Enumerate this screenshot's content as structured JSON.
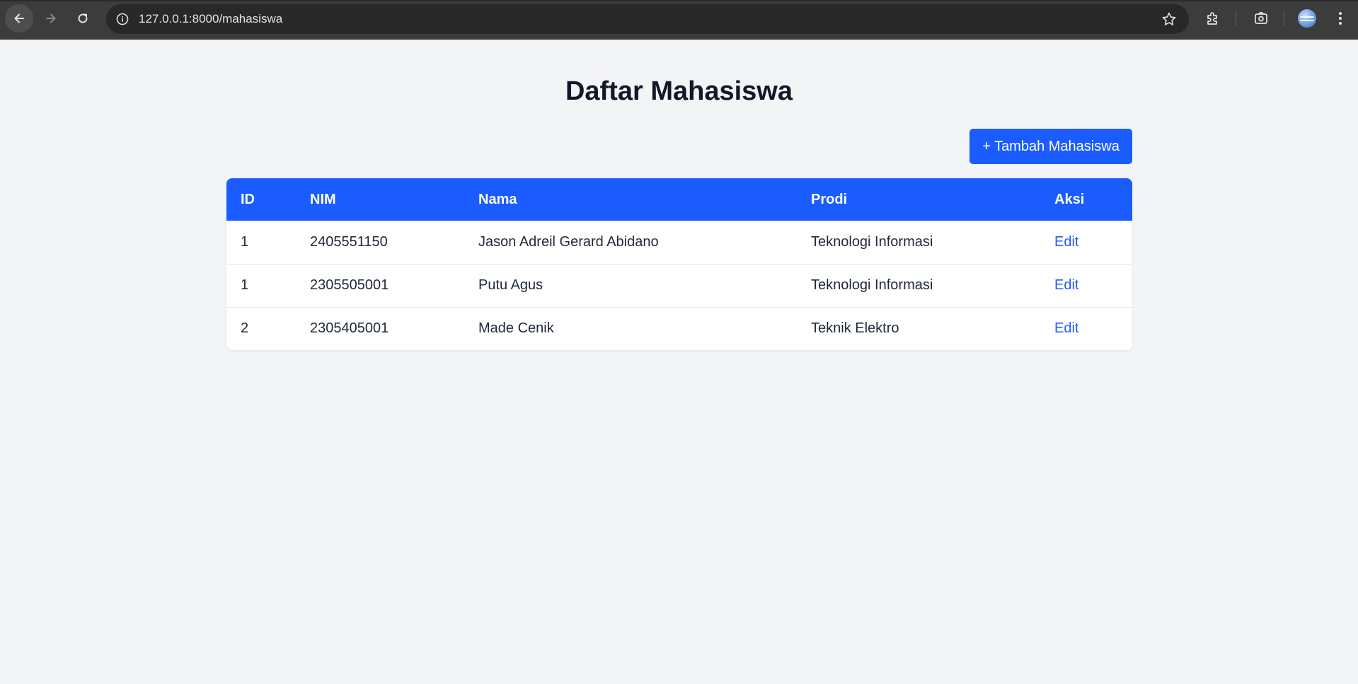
{
  "browser": {
    "url": "127.0.0.1:8000/mahasiswa"
  },
  "page": {
    "title": "Daftar Mahasiswa",
    "add_button_label": "+ Tambah Mahasiswa"
  },
  "table": {
    "headers": {
      "id": "ID",
      "nim": "NIM",
      "nama": "Nama",
      "prodi": "Prodi",
      "aksi": "Aksi"
    },
    "rows": [
      {
        "id": "1",
        "nim": "2405551150",
        "nama": "Jason Adreil Gerard Abidano",
        "prodi": "Teknologi Informasi",
        "aksi": "Edit"
      },
      {
        "id": "1",
        "nim": "2305505001",
        "nama": "Putu Agus",
        "prodi": "Teknologi Informasi",
        "aksi": "Edit"
      },
      {
        "id": "2",
        "nim": "2305405001",
        "nama": "Made Cenik",
        "prodi": "Teknik Elektro",
        "aksi": "Edit"
      }
    ]
  },
  "colors": {
    "accent": "#1a5cff",
    "background": "#f3f4f6",
    "title": "#111827"
  },
  "icons": [
    "back-arrow-icon",
    "forward-arrow-icon",
    "reload-icon",
    "site-info-icon",
    "bookmark-star-icon",
    "extensions-icon",
    "screenshot-icon",
    "profile-avatar-icon",
    "menu-dots-icon"
  ]
}
